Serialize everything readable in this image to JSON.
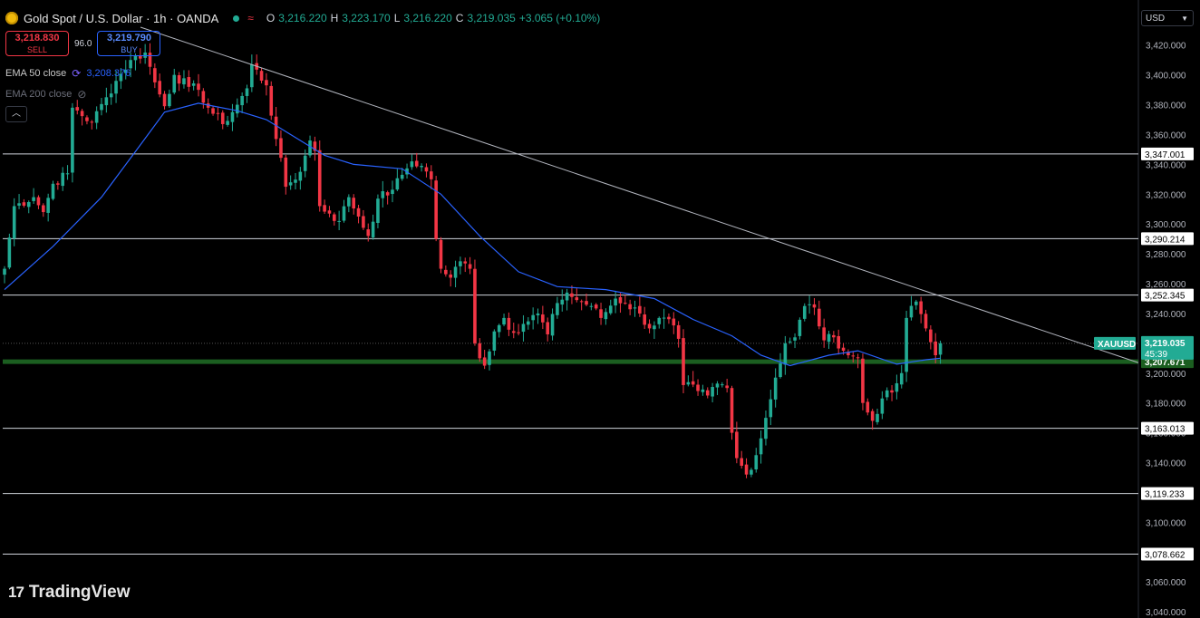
{
  "header": {
    "title": "Gold Spot / U.S. Dollar · 1h · OANDA",
    "ohlc": {
      "open_label": "O",
      "open": "3,216.220",
      "high_label": "H",
      "high": "3,223.170",
      "low_label": "L",
      "low": "3,216.220",
      "close_label": "C",
      "close": "3,219.035",
      "change": "+3.065 (+0.10%)"
    }
  },
  "trade": {
    "sell_price": "3,218.830",
    "sell_label": "SELL",
    "spread": "96.0",
    "buy_price": "3,219.790",
    "buy_label": "BUY"
  },
  "indicators": [
    {
      "label": "EMA 50 close",
      "value": "3,208.376",
      "color": "#2962ff"
    },
    {
      "label": "EMA 200 close"
    }
  ],
  "currency": "USD",
  "branding": "TradingView",
  "chart_data": {
    "type": "candlestick",
    "symbol": "XAUUSD",
    "current_price": "3,219.035",
    "countdown": "45:39",
    "y_ticks": [
      "3,420.000",
      "3,400.000",
      "3,380.000",
      "3,360.000",
      "3,340.000",
      "3,320.000",
      "3,300.000",
      "3,280.000",
      "3,260.000",
      "3,240.000",
      "3,220.000",
      "3,200.000",
      "3,180.000",
      "3,160.000",
      "3,140.000",
      "3,120.000",
      "3,100.000",
      "3,080.000",
      "3,060.000",
      "3,040.000"
    ],
    "ylim": [
      3037,
      3432
    ],
    "horizontal_levels": [
      {
        "value": 3347.001,
        "label": "3,347.001"
      },
      {
        "value": 3290.214,
        "label": "3,290.214"
      },
      {
        "value": 3252.345,
        "label": "3,252.345"
      },
      {
        "value": 3163.013,
        "label": "3,163.013"
      },
      {
        "value": 3119.233,
        "label": "3,119.233"
      },
      {
        "value": 3078.662,
        "label": "3,078.662"
      }
    ],
    "support_zone": {
      "value": 3207.671,
      "label": "3,207.671",
      "color": "#1b5e20"
    },
    "trendline": {
      "from": {
        "bar": 0,
        "price": 3432
      },
      "to": {
        "bar": 190,
        "price": 3207
      }
    },
    "colors": {
      "up": "#22ab94",
      "down": "#f23645",
      "ema": "#2962ff",
      "last_price_bg": "#22ab94"
    },
    "waypoints": [
      [
        0,
        3270
      ],
      [
        2,
        3312
      ],
      [
        6,
        3318
      ],
      [
        8,
        3308
      ],
      [
        10,
        3327
      ],
      [
        13,
        3334
      ],
      [
        14,
        3378
      ],
      [
        18,
        3368
      ],
      [
        21,
        3385
      ],
      [
        23,
        3396
      ],
      [
        26,
        3410
      ],
      [
        29,
        3415
      ],
      [
        31,
        3395
      ],
      [
        33,
        3379
      ],
      [
        35,
        3400
      ],
      [
        38,
        3392
      ],
      [
        40,
        3390
      ],
      [
        42,
        3378
      ],
      [
        45,
        3367
      ],
      [
        48,
        3380
      ],
      [
        50,
        3391
      ],
      [
        51,
        3407
      ],
      [
        54,
        3393
      ],
      [
        56,
        3357
      ],
      [
        58,
        3325
      ],
      [
        61,
        3335
      ],
      [
        63,
        3356
      ],
      [
        64,
        3349
      ],
      [
        65,
        3312
      ],
      [
        67,
        3307
      ],
      [
        69,
        3302
      ],
      [
        71,
        3318
      ],
      [
        73,
        3305
      ],
      [
        75,
        3292
      ],
      [
        77,
        3317
      ],
      [
        80,
        3323
      ],
      [
        82,
        3333
      ],
      [
        84,
        3342
      ],
      [
        86,
        3339
      ],
      [
        88,
        3330
      ],
      [
        89,
        3290
      ],
      [
        90,
        3270
      ],
      [
        92,
        3264
      ],
      [
        94,
        3275
      ],
      [
        96,
        3270
      ],
      [
        97,
        3220
      ],
      [
        99,
        3205
      ],
      [
        101,
        3228
      ],
      [
        103,
        3237
      ],
      [
        105,
        3227
      ],
      [
        107,
        3233
      ],
      [
        110,
        3240
      ],
      [
        112,
        3226
      ],
      [
        114,
        3247
      ],
      [
        116,
        3254
      ],
      [
        118,
        3249
      ],
      [
        121,
        3245
      ],
      [
        123,
        3237
      ],
      [
        126,
        3250
      ],
      [
        128,
        3247
      ],
      [
        131,
        3240
      ],
      [
        133,
        3230
      ],
      [
        135,
        3237
      ],
      [
        138,
        3232
      ],
      [
        139,
        3223
      ],
      [
        140,
        3192
      ],
      [
        143,
        3188
      ],
      [
        145,
        3185
      ],
      [
        147,
        3193
      ],
      [
        149,
        3190
      ],
      [
        150,
        3160
      ],
      [
        151,
        3143
      ],
      [
        153,
        3132
      ],
      [
        155,
        3145
      ],
      [
        157,
        3170
      ],
      [
        159,
        3197
      ],
      [
        161,
        3220
      ],
      [
        163,
        3224
      ],
      [
        165,
        3245
      ],
      [
        167,
        3244
      ],
      [
        169,
        3222
      ],
      [
        171,
        3224
      ],
      [
        174,
        3212
      ],
      [
        176,
        3210
      ],
      [
        177,
        3180
      ],
      [
        179,
        3168
      ],
      [
        181,
        3183
      ],
      [
        183,
        3187
      ],
      [
        185,
        3200
      ],
      [
        186,
        3237
      ],
      [
        188,
        3248
      ],
      [
        190,
        3230
      ],
      [
        192,
        3212
      ],
      [
        193,
        3220
      ]
    ],
    "ema50_points": [
      [
        0,
        3256
      ],
      [
        10,
        3285
      ],
      [
        20,
        3318
      ],
      [
        28,
        3353
      ],
      [
        33,
        3375
      ],
      [
        40,
        3381
      ],
      [
        48,
        3376
      ],
      [
        54,
        3370
      ],
      [
        60,
        3358
      ],
      [
        66,
        3346
      ],
      [
        72,
        3340
      ],
      [
        82,
        3337
      ],
      [
        90,
        3320
      ],
      [
        98,
        3292
      ],
      [
        106,
        3268
      ],
      [
        114,
        3258
      ],
      [
        124,
        3256
      ],
      [
        134,
        3250
      ],
      [
        142,
        3236
      ],
      [
        150,
        3225
      ],
      [
        156,
        3212
      ],
      [
        162,
        3205
      ],
      [
        170,
        3212
      ],
      [
        176,
        3215
      ],
      [
        184,
        3206
      ],
      [
        190,
        3209
      ],
      [
        193,
        3210
      ]
    ]
  }
}
